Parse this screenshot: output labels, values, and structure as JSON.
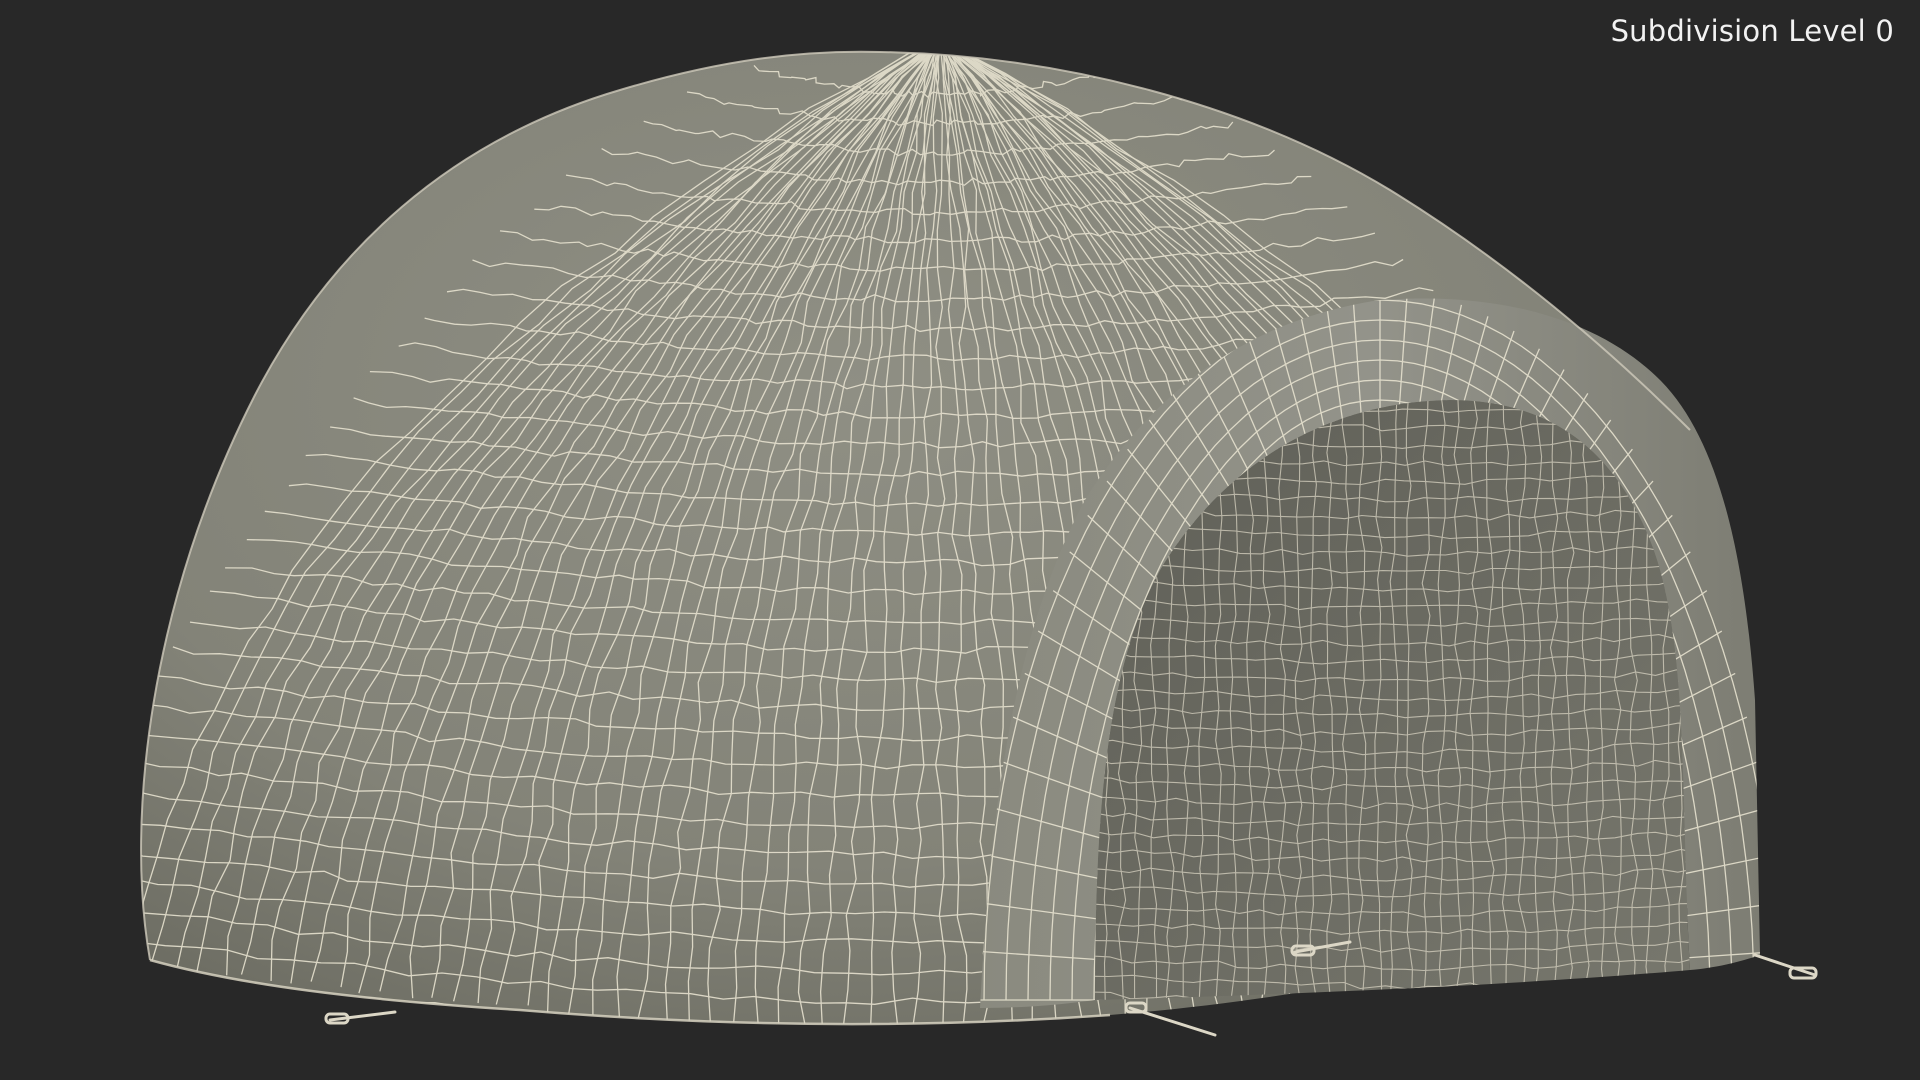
{
  "viewport": {
    "label": "Subdivision Level 0",
    "background_color": "#282828",
    "label_color": "#f2f2f2"
  },
  "model": {
    "subject": "inflatable-dome-tent",
    "render_mode": "wireframe-on-shaded",
    "surface_color": "#85857a",
    "wire_color": "#e6e1cf"
  }
}
